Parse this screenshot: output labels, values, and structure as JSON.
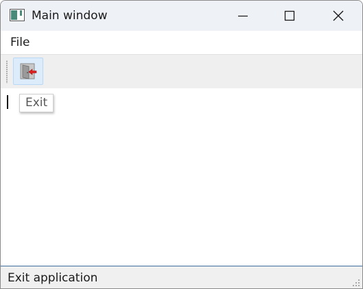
{
  "window": {
    "title": "Main window",
    "app_icon": "app-window-icon",
    "controls": {
      "minimize_icon": "minimize-icon",
      "maximize_icon": "maximize-icon",
      "close_icon": "close-icon"
    }
  },
  "menubar": {
    "items": [
      {
        "label": "File"
      }
    ]
  },
  "toolbar": {
    "buttons": [
      {
        "icon": "exit-door-icon",
        "tooltip": "Exit"
      }
    ]
  },
  "tooltip": {
    "text": "Exit"
  },
  "statusbar": {
    "text": "Exit application"
  },
  "colors": {
    "titlebar_bg": "#eef1f6",
    "toolbar_bg": "#efefef",
    "toolbar_button_hover": "#dcecfb",
    "statusbar_border": "#3c6d9c",
    "exit_arrow": "#e02020"
  }
}
